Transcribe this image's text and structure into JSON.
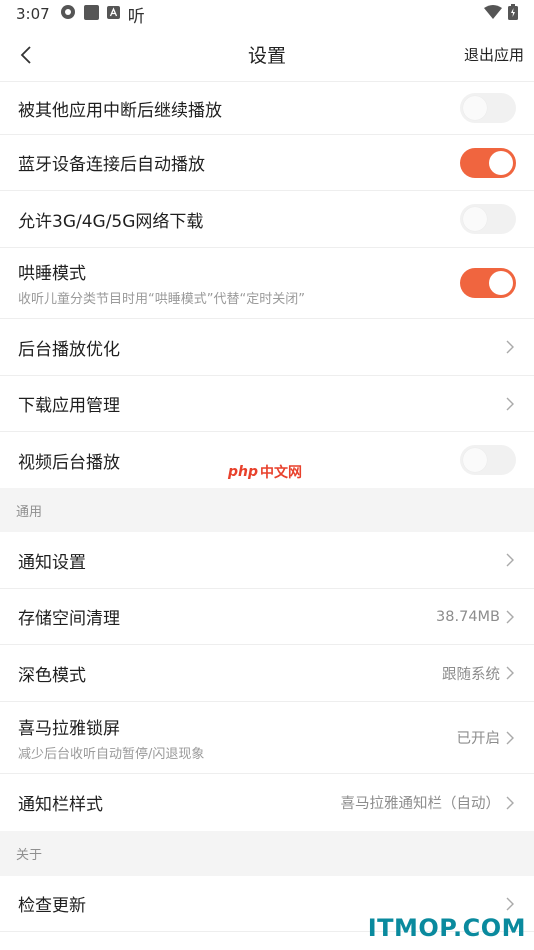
{
  "status_bar": {
    "time": "3:07",
    "app_icons": [
      "settings-cog-icon",
      "square-icon",
      "a-box-icon"
    ],
    "ting_glyph": "听",
    "right_icons": [
      "wifi-icon",
      "battery-charging-icon"
    ]
  },
  "header": {
    "back_icon": "chevron-left-icon",
    "title": "设置",
    "exit_label": "退出应用"
  },
  "rows": {
    "continue_after_interrupt": {
      "label": "被其他应用中断后继续播放",
      "toggle": "off"
    },
    "bluetooth_autoplay": {
      "label": "蓝牙设备连接后自动播放",
      "toggle": "on"
    },
    "mobile_download": {
      "label": "允许3G/4G/5G网络下载",
      "toggle": "off"
    },
    "sleep_mode": {
      "label": "哄睡模式",
      "sub": "收听儿童分类节目时用“哄睡模式”代替“定时关闭”",
      "toggle": "on"
    },
    "background_optimize": {
      "label": "后台播放优化"
    },
    "download_manage": {
      "label": "下载应用管理"
    },
    "video_background": {
      "label": "视频后台播放",
      "toggle": "off"
    },
    "notification_settings": {
      "label": "通知设置"
    },
    "storage_clean": {
      "label": "存储空间清理",
      "value": "38.74MB"
    },
    "dark_mode": {
      "label": "深色模式",
      "value": "跟随系统"
    },
    "lock_screen": {
      "label": "喜马拉雅锁屏",
      "sub": "减少后台收听自动暂停/闪退现象",
      "value": "已开启"
    },
    "notification_style": {
      "label": "通知栏样式",
      "value": "喜马拉雅通知栏（自动）"
    },
    "check_update": {
      "label": "检查更新"
    }
  },
  "sections": {
    "general": "通用",
    "about": "关于"
  },
  "watermarks": {
    "php_left": "php",
    "php_right": "中文网",
    "itmop": "ITMOP.COM"
  },
  "colors": {
    "accent": "#f0653f",
    "toggle_off": "#f1f1f1",
    "section_bg": "#f4f4f4"
  }
}
